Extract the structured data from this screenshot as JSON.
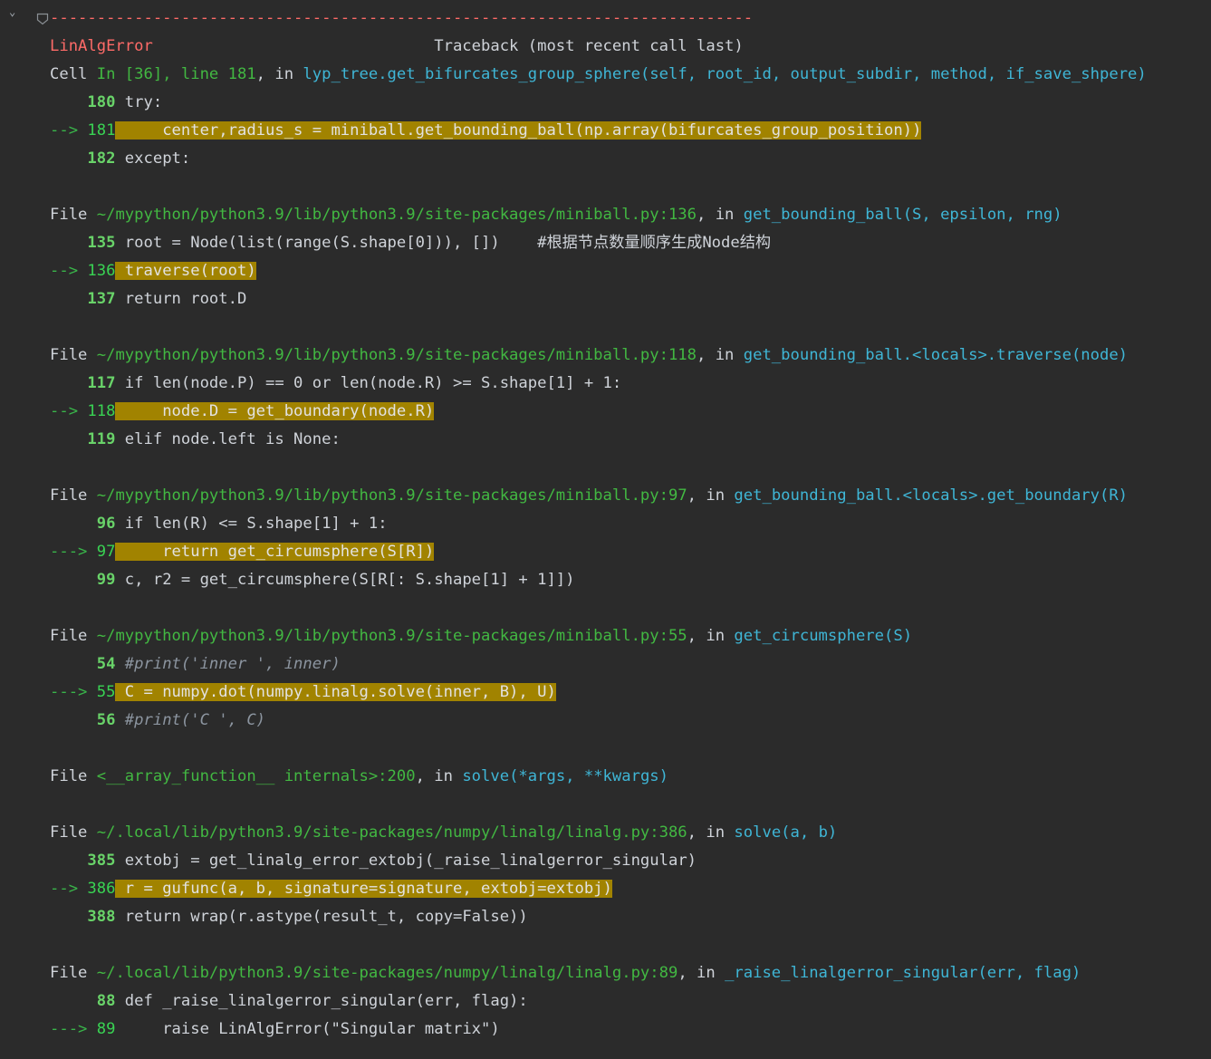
{
  "traceback": {
    "separator": "---------------------------------------------------------------------------",
    "error_name": "LinAlgError",
    "header_text": "Traceback (most recent call last)",
    "frames": [
      {
        "kind": "cell",
        "file_label": "Cell ",
        "location": "In [36], line 181",
        "in_text": ", in ",
        "func_name": "lyp_tree.get_bifurcates_group_sphere",
        "func_args": "(self, root_id, output_subdir, method, if_save_shpere)",
        "lines": [
          {
            "arrow": "    ",
            "num": "180",
            "code": " try:"
          },
          {
            "arrow": "--> ",
            "num": "181",
            "code": "     center,radius_s = miniball.get_bounding_ball(np.array(bifurcates_group_position))"
          },
          {
            "arrow": "    ",
            "num": "182",
            "code": " except:"
          }
        ]
      },
      {
        "kind": "file",
        "file_label": "File ",
        "location": "~/mypython/python3.9/lib/python3.9/site-packages/miniball.py:136",
        "in_text": ", in ",
        "func_name": "get_bounding_ball",
        "func_args": "(S, epsilon, rng)",
        "lines": [
          {
            "arrow": "    ",
            "num": "135",
            "code": " root = Node(list(range(S.shape[0])), [])    #根据节点数量顺序生成Node结构"
          },
          {
            "arrow": "--> ",
            "num": "136",
            "code": " traverse(root)"
          },
          {
            "arrow": "    ",
            "num": "137",
            "code": " return root.D"
          }
        ]
      },
      {
        "kind": "file",
        "file_label": "File ",
        "location": "~/mypython/python3.9/lib/python3.9/site-packages/miniball.py:118",
        "in_text": ", in ",
        "func_name": "get_bounding_ball.<locals>.traverse",
        "func_args": "(node)",
        "lines": [
          {
            "arrow": "    ",
            "num": "117",
            "code": " if len(node.P) == 0 or len(node.R) >= S.shape[1] + 1:"
          },
          {
            "arrow": "--> ",
            "num": "118",
            "code": "     node.D = get_boundary(node.R)"
          },
          {
            "arrow": "    ",
            "num": "119",
            "code": " elif node.left is None:"
          }
        ]
      },
      {
        "kind": "file",
        "file_label": "File ",
        "location": "~/mypython/python3.9/lib/python3.9/site-packages/miniball.py:97",
        "in_text": ", in ",
        "func_name": "get_bounding_ball.<locals>.get_boundary",
        "func_args": "(R)",
        "lines": [
          {
            "arrow": "     ",
            "num": "96",
            "code": " if len(R) <= S.shape[1] + 1:"
          },
          {
            "arrow": "---> ",
            "num": "97",
            "code": "     return get_circumsphere(S[R])"
          },
          {
            "arrow": "     ",
            "num": "99",
            "code": " c, r2 = get_circumsphere(S[R[: S.shape[1] + 1]])"
          }
        ]
      },
      {
        "kind": "file",
        "file_label": "File ",
        "location": "~/mypython/python3.9/lib/python3.9/site-packages/miniball.py:55",
        "in_text": ", in ",
        "func_name": "get_circumsphere",
        "func_args": "(S)",
        "lines": [
          {
            "arrow": "     ",
            "num": "54",
            "code": " #print('inner ', inner)"
          },
          {
            "arrow": "---> ",
            "num": "55",
            "code": " C = numpy.dot(numpy.linalg.solve(inner, B), U)"
          },
          {
            "arrow": "     ",
            "num": "56",
            "code": " #print('C ', C)"
          }
        ]
      },
      {
        "kind": "file",
        "file_label": "File ",
        "location": "<__array_function__ internals>:200",
        "in_text": ", in ",
        "func_name": "solve",
        "func_args": "(*args, **kwargs)",
        "lines": []
      },
      {
        "kind": "file",
        "file_label": "File ",
        "location": "~/.local/lib/python3.9/site-packages/numpy/linalg/linalg.py:386",
        "in_text": ", in ",
        "func_name": "solve",
        "func_args": "(a, b)",
        "lines": [
          {
            "arrow": "    ",
            "num": "385",
            "code": " extobj = get_linalg_error_extobj(_raise_linalgerror_singular)"
          },
          {
            "arrow": "--> ",
            "num": "386",
            "code": " r = gufunc(a, b, signature=signature, extobj=extobj)"
          },
          {
            "arrow": "    ",
            "num": "388",
            "code": " return wrap(r.astype(result_t, copy=False))"
          }
        ]
      },
      {
        "kind": "file",
        "file_label": "File ",
        "location": "~/.local/lib/python3.9/site-packages/numpy/linalg/linalg.py:89",
        "in_text": ", in ",
        "func_name": "_raise_linalgerror_singular",
        "func_args": "(err, flag)",
        "lines": [
          {
            "arrow": "     ",
            "num": "88",
            "code": " def _raise_linalgerror_singular(err, flag):"
          },
          {
            "arrow": "---> ",
            "num": "89",
            "code": "     raise LinAlgError(\"Singular matrix\")"
          }
        ]
      }
    ]
  },
  "icons": {
    "collapse": "chevron-down-icon",
    "breakpoint": "breakpoint-marker-icon"
  }
}
